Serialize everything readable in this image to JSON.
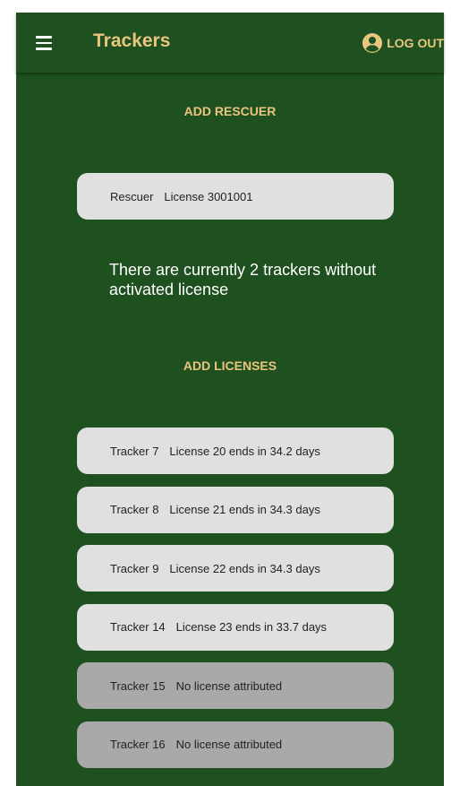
{
  "app_bar": {
    "title": "Trackers",
    "menu_icon": "hamburger-menu-icon",
    "logout_icon": "account-circle-icon",
    "logout_label": "LOG OUT"
  },
  "rescuer_section": {
    "add_button_label": "ADD RESCUER",
    "rescuer": {
      "name": "Rescuer",
      "license": "License 3001001"
    }
  },
  "notice": {
    "text": "There are currently 2 trackers without activated license"
  },
  "trackers_section": {
    "add_button_label": "ADD LICENSES",
    "trackers": [
      {
        "name": "Tracker 7",
        "license": "License 20 ends in 34.2 days",
        "activated": true
      },
      {
        "name": "Tracker 8",
        "license": "License 21 ends in 34.3 days",
        "activated": true
      },
      {
        "name": "Tracker 9",
        "license": "License 22 ends in 34.3 days",
        "activated": true
      },
      {
        "name": "Tracker 14",
        "license": "License 23 ends in 33.7 days",
        "activated": true
      },
      {
        "name": "Tracker 15",
        "license": "No license attributed",
        "activated": false
      },
      {
        "name": "Tracker 16",
        "license": "No license attributed",
        "activated": false
      }
    ]
  },
  "colors": {
    "background": "#1f5120",
    "accent": "#e9c57e",
    "card_active": "#e0e0e0",
    "card_inactive": "#a9a9a9"
  }
}
